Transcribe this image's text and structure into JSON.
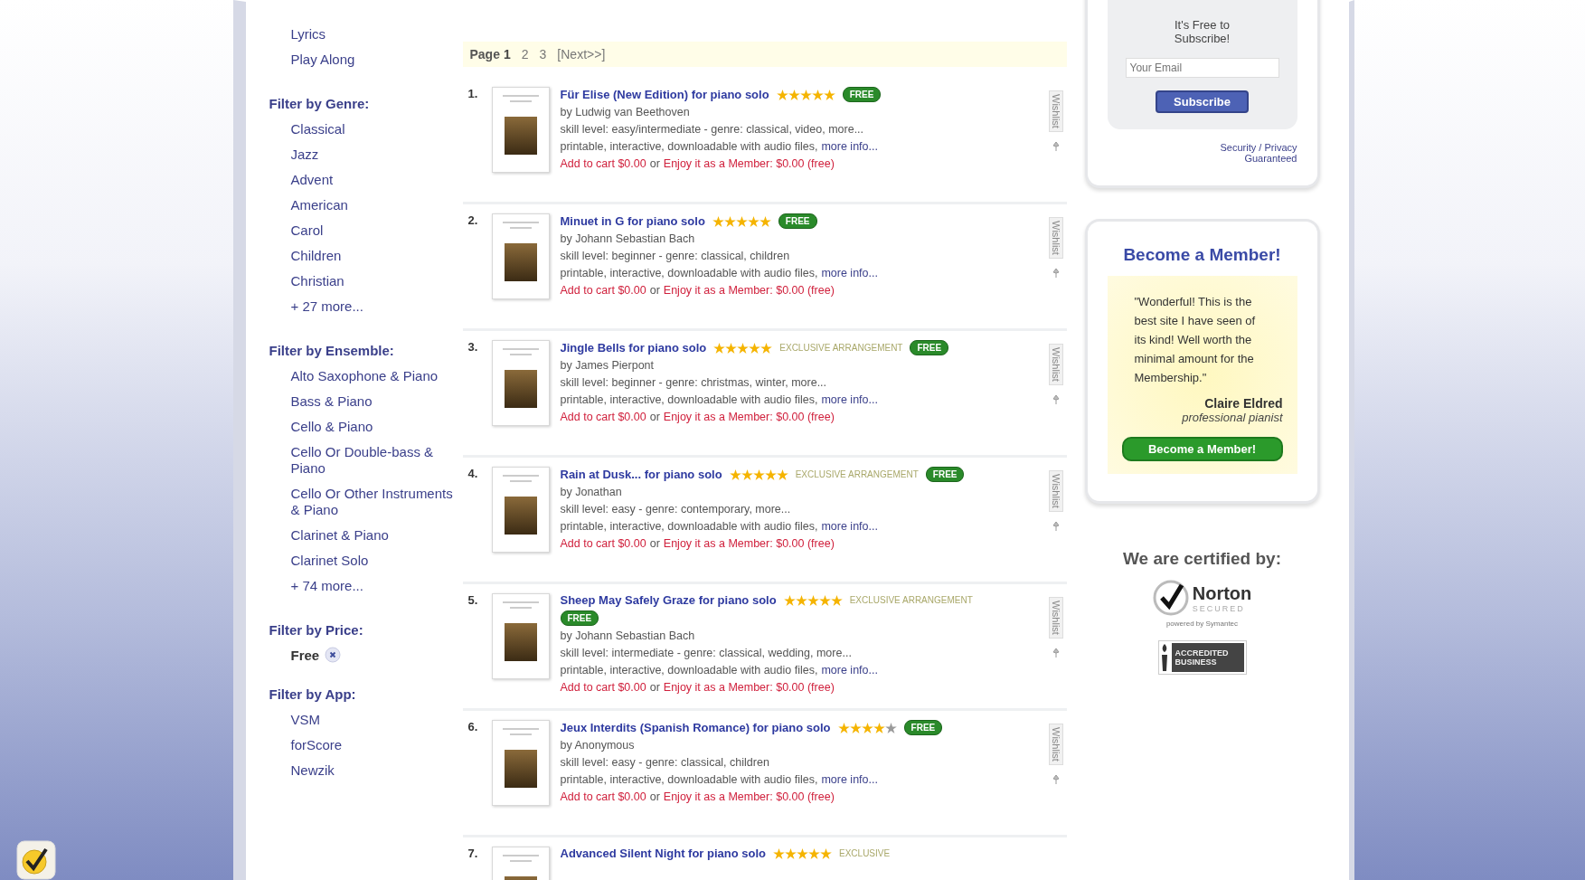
{
  "sidebar": {
    "top_links": [
      "Lyrics",
      "Play Along"
    ],
    "filters": [
      {
        "heading": "Filter by Genre:",
        "items": [
          "Classical",
          "Jazz",
          "Advent",
          "American",
          "Carol",
          "Children",
          "Christian"
        ],
        "more": "+ 27 more..."
      },
      {
        "heading": "Filter by Ensemble:",
        "items": [
          "Alto Saxophone & Piano",
          "Bass & Piano",
          "Cello & Piano",
          "Cello Or Double-bass & Piano",
          "Cello Or Other Instruments & Piano",
          "Clarinet & Piano",
          "Clarinet Solo"
        ],
        "more": "+ 74 more..."
      },
      {
        "heading": "Filter by Price:",
        "active": "Free"
      },
      {
        "heading": "Filter by App:",
        "items": [
          "VSM",
          "forScore",
          "Newzik"
        ]
      }
    ]
  },
  "pager": {
    "label": "Page",
    "pages": [
      {
        "label": "1",
        "selected": true
      },
      {
        "label": "2",
        "selected": false
      },
      {
        "label": "3",
        "selected": false
      }
    ],
    "next": "[Next>>]"
  },
  "results": [
    {
      "number": "1.",
      "title": "Für Elise (New Edition) for piano solo",
      "stars": 5,
      "badge": "FREE",
      "author": "by Ludwig van Beethoven",
      "details": "skill level: easy/intermediate - genre: classical, video, more...",
      "features": "printable, interactive, downloadable with audio files,",
      "more_link": "more info...",
      "cart_link": "Add to cart $0.00",
      "or": "or",
      "member_link": "Enjoy it as a Member: $0.00 (free)",
      "side_label": "Wishlist"
    },
    {
      "number": "2.",
      "title": "Minuet in G for piano solo",
      "stars": 5,
      "badge": "FREE",
      "author": "by Johann Sebastian Bach",
      "details": "skill level: beginner - genre: classical, children",
      "features": "printable, interactive, downloadable with audio files,",
      "more_link": "more info...",
      "cart_link": "Add to cart $0.00",
      "or": "or",
      "member_link": "Enjoy it as a Member: $0.00 (free)",
      "side_label": "Wishlist"
    },
    {
      "number": "3.",
      "title": "Jingle Bells for piano solo",
      "stars": 5,
      "tag": "EXCLUSIVE ARRANGEMENT",
      "badge": "FREE",
      "author": "by James Pierpont",
      "details": "skill level: beginner - genre: christmas, winter, more...",
      "features": "printable, interactive, downloadable with audio files,",
      "more_link": "more info...",
      "cart_link": "Add to cart $0.00",
      "or": "or",
      "member_link": "Enjoy it as a Member: $0.00 (free)",
      "side_label": "Wishlist"
    },
    {
      "number": "4.",
      "title": "Rain at Dusk... for piano solo",
      "stars": 5,
      "tag": "EXCLUSIVE ARRANGEMENT",
      "badge": "FREE",
      "author": "by Jonathan",
      "details": "skill level: easy - genre: contemporary, more...",
      "features": "printable, interactive, downloadable with audio files,",
      "more_link": "more info...",
      "cart_link": "Add to cart $0.00",
      "or": "or",
      "member_link": "Enjoy it as a Member: $0.00 (free)",
      "side_label": "Wishlist"
    },
    {
      "number": "5.",
      "title": "Sheep May Safely Graze for piano solo",
      "stars": 5,
      "tag": "EXCLUSIVE ARRANGEMENT",
      "badge": "FREE",
      "author": "by Johann Sebastian Bach",
      "details": "skill level: intermediate - genre: classical, wedding, more...",
      "features": "printable, interactive, downloadable with audio files,",
      "more_link": "more info...",
      "cart_link": "Add to cart $0.00",
      "or": "or",
      "member_link": "Enjoy it as a Member: $0.00 (free)",
      "side_label": "Wishlist"
    },
    {
      "number": "6.",
      "title": "Jeux Interdits (Spanish Romance) for piano solo",
      "stars": 4,
      "badge": "FREE",
      "author": "by Anonymous",
      "details": "skill level: easy - genre: classical, children",
      "features": "printable, interactive, downloadable with audio files,",
      "more_link": "more info...",
      "cart_link": "Add to cart $0.00",
      "or": "or",
      "member_link": "Enjoy it as a Member: $0.00 (free)",
      "side_label": "Wishlist"
    },
    {
      "number": "7.",
      "title": "Advanced Silent Night for piano solo",
      "stars": 5,
      "tag": "EXCLUSIVE"
    }
  ],
  "subscribe": {
    "heading": "It's Free to Subscribe!",
    "placeholder": "Your Email",
    "button": "Subscribe",
    "privacy_link": "Security / Privacy Guaranteed"
  },
  "membership": {
    "heading": "Become a Member!",
    "quote": "\"Wonderful! This is the best site I have seen of its kind! Well worth the minimal amount for the Membership.\"",
    "author": "Claire Eldred",
    "role": "professional pianist",
    "button": "Become a Member!"
  },
  "certified": {
    "heading": "We are certified by:",
    "norton_name": "Norton",
    "norton_sub": "SECURED",
    "norton_powered": "powered by Symantec",
    "bbb_text": "ACCREDITED BUSINESS"
  }
}
